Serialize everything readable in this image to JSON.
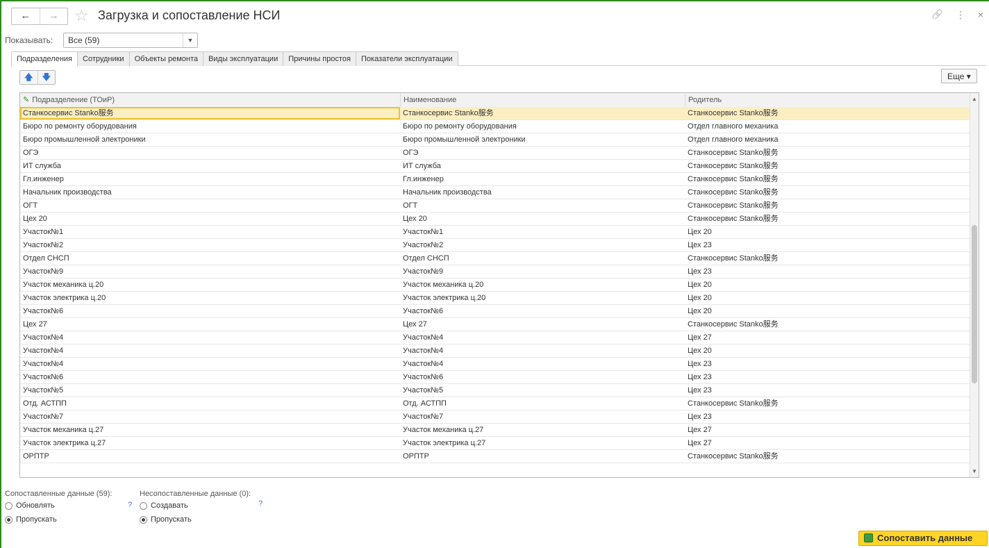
{
  "window": {
    "title": "Загрузка и сопоставление НСИ",
    "back_icon": "←",
    "forward_icon": "→",
    "star_icon": "☆",
    "link_icon": "🔗",
    "menu_icon": "⋮",
    "close_icon": "×"
  },
  "show": {
    "label": "Показывать:",
    "value": "Все (59)"
  },
  "tabs": [
    {
      "label": "Подразделения"
    },
    {
      "label": "Сотрудники"
    },
    {
      "label": "Объекты ремонта"
    },
    {
      "label": "Виды эксплуатации"
    },
    {
      "label": "Причины простоя"
    },
    {
      "label": "Показатели эксплуатации"
    }
  ],
  "toolbar": {
    "up_icon": "🡅",
    "down_icon": "🡇",
    "more_label": "Еще ▾"
  },
  "table": {
    "columns": [
      "Подразделение (ТОиР)",
      "Наименование",
      "Родитель"
    ],
    "rows": [
      [
        "Станкосервис Stanko服务",
        "Станкосервис Stanko服务",
        "Станкосервис Stanko服务"
      ],
      [
        "Бюро по ремонту оборудования",
        "Бюро по ремонту оборудования",
        "Отдел главного механика"
      ],
      [
        "Бюро промышленной электроники",
        "Бюро промышленной электроники",
        "Отдел главного механика"
      ],
      [
        "ОГЭ",
        "ОГЭ",
        "Станкосервис Stanko服务"
      ],
      [
        "ИТ служба",
        "ИТ служба",
        "Станкосервис Stanko服务"
      ],
      [
        "Гл.инженер",
        "Гл.инженер",
        "Станкосервис Stanko服务"
      ],
      [
        "Начальник производства",
        "Начальник производства",
        "Станкосервис Stanko服务"
      ],
      [
        "ОГТ",
        "ОГТ",
        "Станкосервис Stanko服务"
      ],
      [
        "Цех 20",
        "Цех 20",
        "Станкосервис Stanko服务"
      ],
      [
        "Участок№1",
        "Участок№1",
        "Цех 20"
      ],
      [
        "Участок№2",
        "Участок№2",
        "Цех 23"
      ],
      [
        "Отдел СНСП",
        "Отдел СНСП",
        "Станкосервис Stanko服务"
      ],
      [
        "Участок№9",
        "Участок№9",
        "Цех 23"
      ],
      [
        "Участок механика ц.20",
        "Участок механика ц.20",
        "Цех 20"
      ],
      [
        "Участок электрика ц.20",
        "Участок электрика ц.20",
        "Цех 20"
      ],
      [
        "Участок№6",
        "Участок№6",
        "Цех 20"
      ],
      [
        "Цех 27",
        "Цех 27",
        "Станкосервис Stanko服务"
      ],
      [
        "Участок№4",
        "Участок№4",
        "Цех 27"
      ],
      [
        "Участок№4",
        "Участок№4",
        "Цех 20"
      ],
      [
        "Участок№4",
        "Участок№4",
        "Цех 23"
      ],
      [
        "Участок№6",
        "Участок№6",
        "Цех 23"
      ],
      [
        "Участок№5",
        "Участок№5",
        "Цех 23"
      ],
      [
        "Отд. АСТПП",
        "Отд. АСТПП",
        "Станкосервис Stanko服务"
      ],
      [
        "Участок№7",
        "Участок№7",
        "Цех 23"
      ],
      [
        "Участок механика ц.27",
        "Участок механика ц.27",
        "Цех 27"
      ],
      [
        "Участок электрика ц.27",
        "Участок электрика ц.27",
        "Цех 27"
      ],
      [
        "ОРПТР",
        "ОРПТР",
        "Станкосервис Stanko服务"
      ]
    ]
  },
  "options": {
    "matched_label": "Сопоставленные данные (59):",
    "matched_update": "Обновлять",
    "matched_skip": "Пропускать",
    "unmatched_label": "Несопоставленные данные (0):",
    "unmatched_create": "Создавать",
    "unmatched_skip": "Пропускать",
    "help": "?"
  },
  "actions": {
    "match_label": "Сопоставить данные"
  }
}
